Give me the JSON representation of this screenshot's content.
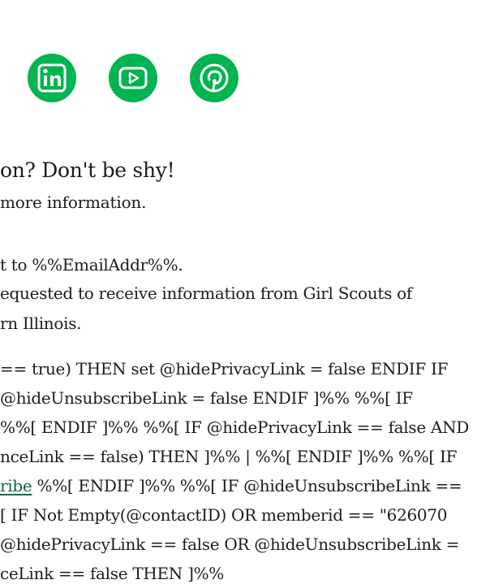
{
  "colors": {
    "brand_green": "#00b450",
    "link_green": "#0b6b3a",
    "text": "#1c1c1c",
    "background": "#ffffff"
  },
  "social": {
    "icons": [
      "linkedin-icon",
      "youtube-icon",
      "pinterest-icon"
    ]
  },
  "question": {
    "headline": "on? Don't be shy!",
    "subline": "more information."
  },
  "footer": {
    "sent_to": "t to %%EmailAddr%%.",
    "requested_line1": "equested to receive information from Girl Scouts of",
    "requested_line2": "rn Illinois."
  },
  "code": {
    "line1": "== true) THEN set @hidePrivacyLink = false ENDIF IF",
    "line2": " @hideUnsubscribeLink = false ENDIF ]%% %%[ IF",
    "line3": "%%[ ENDIF ]%% %%[ IF @hidePrivacyLink == false AND",
    "line4": "nceLink == false) THEN ]%% | %%[ ENDIF ]%% %%[ IF",
    "line5_link": "ribe",
    "line5_rest": " %%[ ENDIF ]%% %%[ IF @hideUnsubscribeLink ==",
    "line6": " [ IF Not Empty(@contactID) OR memberid == \"626070",
    "line7": "@hidePrivacyLink == false OR @hideUnsubscribeLink =",
    "line8": "ceLink == false THEN ]%%"
  }
}
